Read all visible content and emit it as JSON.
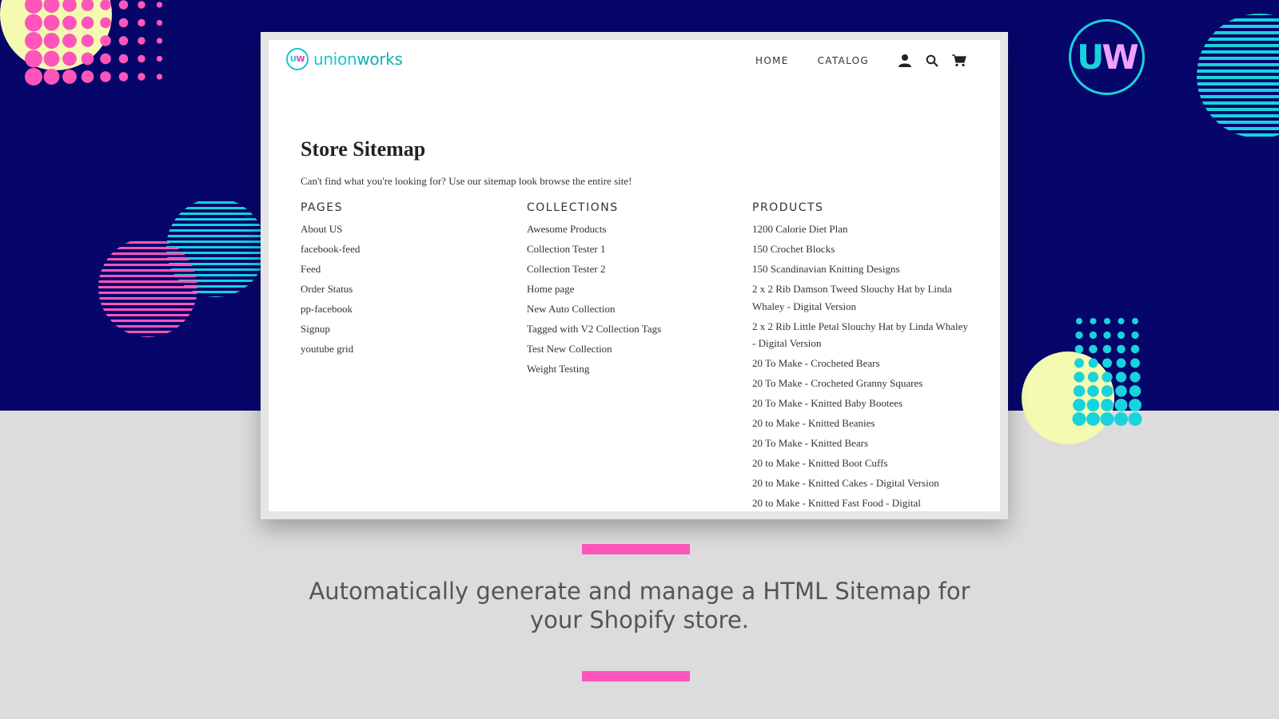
{
  "brand": {
    "logo_mark_u": "U",
    "logo_mark_w": "W",
    "word_union": "union",
    "word_works": "works",
    "badge_u": "U",
    "badge_w": "W"
  },
  "nav": {
    "home": "HOME",
    "catalog": "CATALOG",
    "account_icon": "user-icon",
    "search_icon": "search-icon",
    "cart_icon": "cart-icon"
  },
  "page": {
    "title": "Store Sitemap",
    "intro": "Can't find what you're looking for? Use our sitemap look browse the entire site!"
  },
  "columns": {
    "pages": {
      "heading": "PAGES",
      "items": [
        "About US",
        "facebook-feed",
        "Feed",
        "Order Status",
        "pp-facebook",
        "Signup",
        "youtube grid"
      ]
    },
    "collections": {
      "heading": "COLLECTIONS",
      "items": [
        "Awesome Products",
        "Collection Tester 1",
        "Collection Tester 2",
        "Home page",
        "New Auto Collection",
        "Tagged with V2 Collection Tags",
        "Test New Collection",
        "Weight Testing"
      ]
    },
    "products": {
      "heading": "PRODUCTS",
      "items": [
        "1200 Calorie Diet Plan",
        "150 Crochet Blocks",
        "150 Scandinavian Knitting Designs",
        "2 x 2 Rib Damson Tweed Slouchy Hat by Linda Whaley - Digital Version",
        "2 x 2 Rib Little Petal Slouchy Hat by Linda Whaley - Digital Version",
        "20 To Make - Crocheted Bears",
        "20 To Make - Crocheted Granny Squares",
        "20 To Make - Knitted Baby Bootees",
        "20 to Make - Knitted Beanies",
        "20 To Make - Knitted Bears",
        "20 to Make - Knitted Boot Cuffs",
        "20 to Make - Knitted Cakes - Digital Version",
        "20 to Make - Knitted Fast Food - Digital"
      ]
    }
  },
  "caption": {
    "line1": "Automatically generate and manage a HTML Sitemap for",
    "line2": "your Shopify store."
  },
  "colors": {
    "navy": "#06066a",
    "pink": "#fe55bb",
    "cyan": "#19d2dc",
    "yellow": "#f4fbb0",
    "grey": "#dcdcdc"
  }
}
